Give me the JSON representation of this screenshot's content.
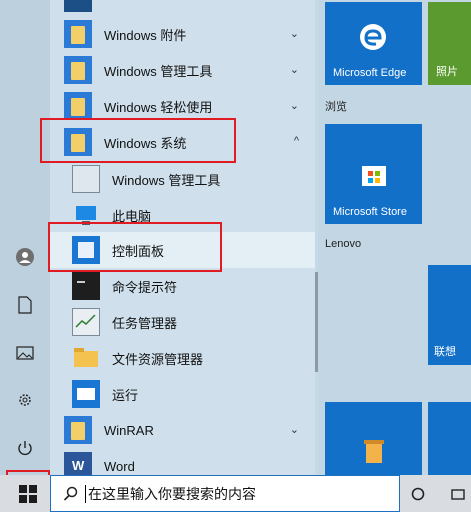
{
  "applist": {
    "items": [
      {
        "label": "Windows 附件",
        "chevron": "⌄"
      },
      {
        "label": "Windows 管理工具",
        "chevron": "⌄"
      },
      {
        "label": "Windows 轻松使用",
        "chevron": "⌄"
      },
      {
        "label": "Windows 系统",
        "chevron": "^"
      },
      {
        "label": "Windows 管理工具"
      },
      {
        "label": "此电脑"
      },
      {
        "label": "控制面板"
      },
      {
        "label": "命令提示符"
      },
      {
        "label": "任务管理器"
      },
      {
        "label": "文件资源管理器"
      },
      {
        "label": "运行"
      },
      {
        "label": "WinRAR",
        "chevron": "⌄"
      },
      {
        "label": "Word"
      }
    ]
  },
  "tiles": {
    "edge_label": "Microsoft Edge",
    "photos_label": "照片",
    "browse_group": "浏览",
    "store_label": "Microsoft Store",
    "lenovo_group": "Lenovo",
    "lenovo_label": "联想"
  },
  "search": {
    "placeholder": "在这里输入你要搜索的内容"
  },
  "colors": {
    "accent": "#1270c9",
    "highlight": "#e01b24"
  }
}
